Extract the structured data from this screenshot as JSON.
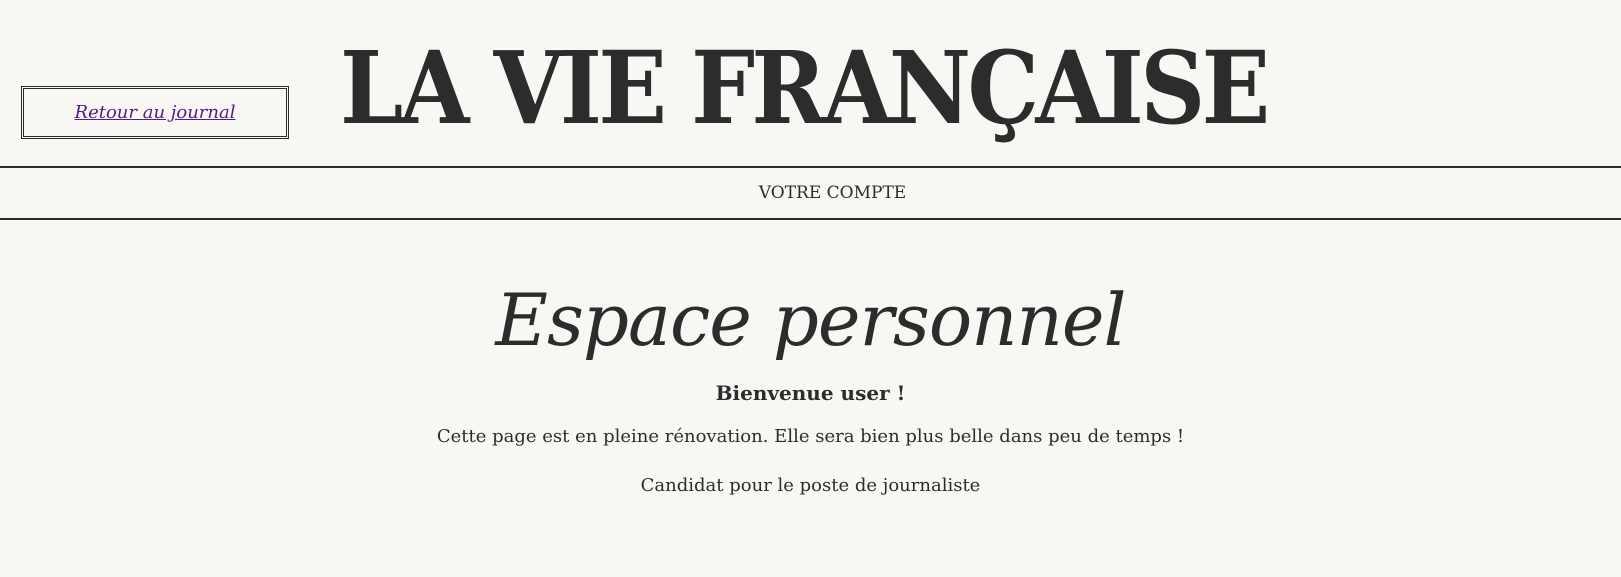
{
  "header": {
    "back_link": "Retour au journal",
    "masthead": "LA VIE FRANÇAISE"
  },
  "nav": {
    "account_link": "VOTRE COMPTE"
  },
  "main": {
    "title": "Espace personnel",
    "welcome": "Bienvenue user !",
    "renovation_notice": "Cette page est en pleine rénovation. Elle sera bien plus belle dans peu de temps !",
    "candidate_link": "Candidat pour le poste de journaliste"
  },
  "colors": {
    "background": "#f9f7f3",
    "text": "#2c2c2c",
    "link_visited": "#551a8b"
  }
}
